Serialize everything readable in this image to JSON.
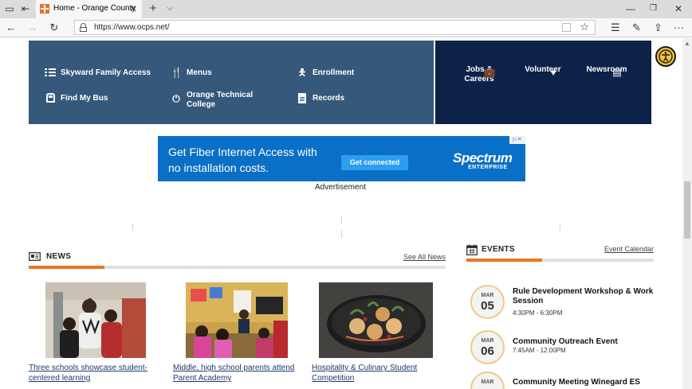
{
  "browser": {
    "tab_title": "Home - Orange County",
    "url": "https://www.ocps.net/",
    "icons": [
      "tab-actions-icon",
      "set-aside-icon",
      "orange-county-favicon",
      "close-icon",
      "new-tab-icon",
      "tab-preview-icon",
      "minimize-icon",
      "restore-icon",
      "close-window-icon",
      "back-icon",
      "forward-icon",
      "refresh-icon",
      "lock-icon",
      "reading-view-icon",
      "favorite-star-icon",
      "favorites-hub-icon",
      "pen-icon",
      "share-icon",
      "more-icon"
    ]
  },
  "quick_links": [
    {
      "label": "Skyward Family Access",
      "icon": "grid-icon"
    },
    {
      "label": "Menus",
      "icon": "fork-knife-icon"
    },
    {
      "label": "Enrollment",
      "icon": "person-icon"
    },
    {
      "label": "Find My Bus",
      "icon": "bus-icon"
    },
    {
      "label": "Orange Technical College",
      "icon": "power-icon"
    },
    {
      "label": "Records",
      "icon": "document-icon"
    }
  ],
  "featured_links": [
    {
      "label": "Jobs & Careers",
      "icon": "briefcase-icon"
    },
    {
      "label": "Volunteer",
      "icon": "heart-icon"
    },
    {
      "label": "Newsroom",
      "icon": "newspaper-icon"
    }
  ],
  "accessibility": {
    "icon": "accessibility-icon"
  },
  "ad": {
    "text": "Get Fiber Internet Access with no installation costs.",
    "button": "Get connected",
    "brand": "Spectrum",
    "brand_sub": "ENTERPRISE",
    "close": "▷✕",
    "label": "Advertisement"
  },
  "news": {
    "title": "NEWS",
    "see_all": "See All News",
    "items": [
      {
        "caption": "Three schools showcase student-centered learning"
      },
      {
        "caption": "Middle, high school parents attend Parent Academy"
      },
      {
        "caption": "Hospitality & Culinary Student Competition"
      }
    ]
  },
  "events": {
    "title": "EVENTS",
    "calendar_link": "Event Calendar",
    "items": [
      {
        "month": "MAR",
        "day": "05",
        "title": "Rule Development Workshop & Work Session",
        "time": "4:30PM - 6:30PM"
      },
      {
        "month": "MAR",
        "day": "06",
        "title": "Community Outreach Event",
        "time": "7:45AM - 12:00PM"
      },
      {
        "month": "MAR",
        "day": "",
        "title": "Community Meeting Winegard ES",
        "time": ""
      }
    ]
  },
  "colors": {
    "quick_links_bg": "#36587a",
    "featured_bg": "#0d2249",
    "accent_orange": "#e87722",
    "ad_blue": "#0a6fc6",
    "link_blue": "#1b3a6b"
  }
}
